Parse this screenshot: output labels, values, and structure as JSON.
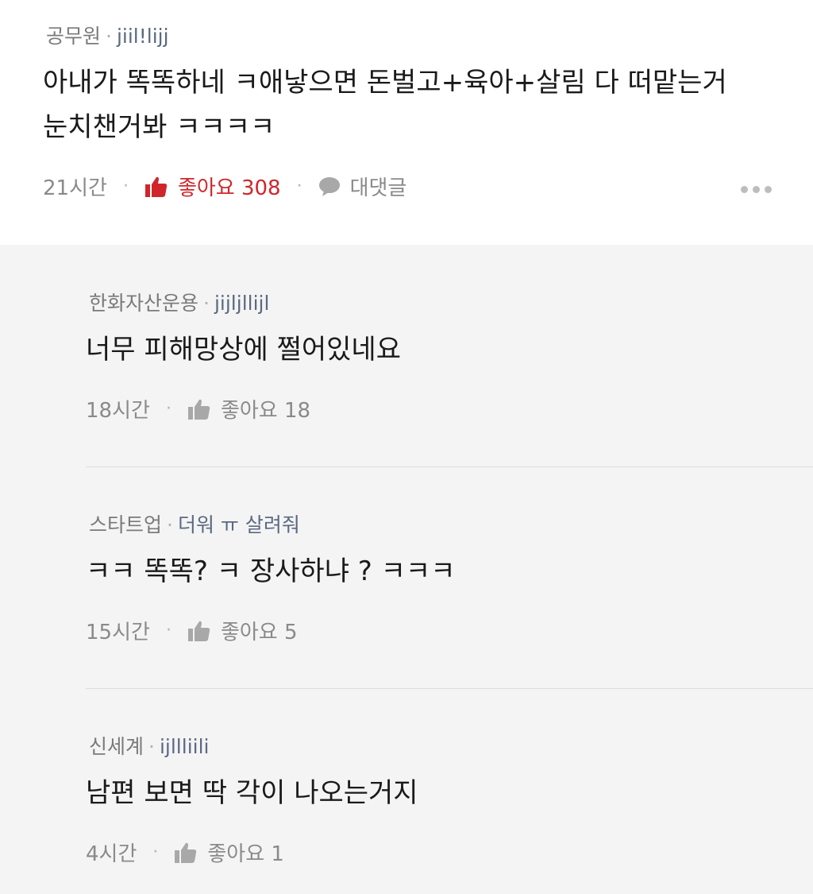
{
  "top_comment": {
    "company": "공무원",
    "nickname": "jiil!lijj",
    "text_line1": "아내가 똑똑하네 ㅋ애낳으면 돈벌고+육아+살림 다 떠맡는거",
    "text_line2": "눈치챈거봐 ㅋㅋㅋㅋ",
    "time": "21시간",
    "like_label": "좋아요 308",
    "reply_label": "대댓글"
  },
  "replies": [
    {
      "company": "한화자산운용",
      "nickname": "jijljllijl",
      "text": "너무 피해망상에 쩔어있네요",
      "time": "18시간",
      "like_label": "좋아요 18"
    },
    {
      "company": "스타트업",
      "nickname": "더워 ㅠ 살려줘",
      "text": "ㅋㅋ 똑똑? ㅋ 장사하냐 ? ㅋㅋㅋ",
      "time": "15시간",
      "like_label": "좋아요 5"
    },
    {
      "company": "신세계",
      "nickname": "ijllliili",
      "text": "남편 보면 딱 각이 나오는거지",
      "time": "4시간",
      "like_label": "좋아요 1"
    }
  ],
  "colors": {
    "like_active": "#d0262b",
    "muted": "#8a8a8a",
    "nickname": "#5a6a82"
  },
  "icons": {
    "like": "thumbs-up-icon",
    "reply": "speech-bubble-icon",
    "more": "more-horizontal-icon"
  }
}
